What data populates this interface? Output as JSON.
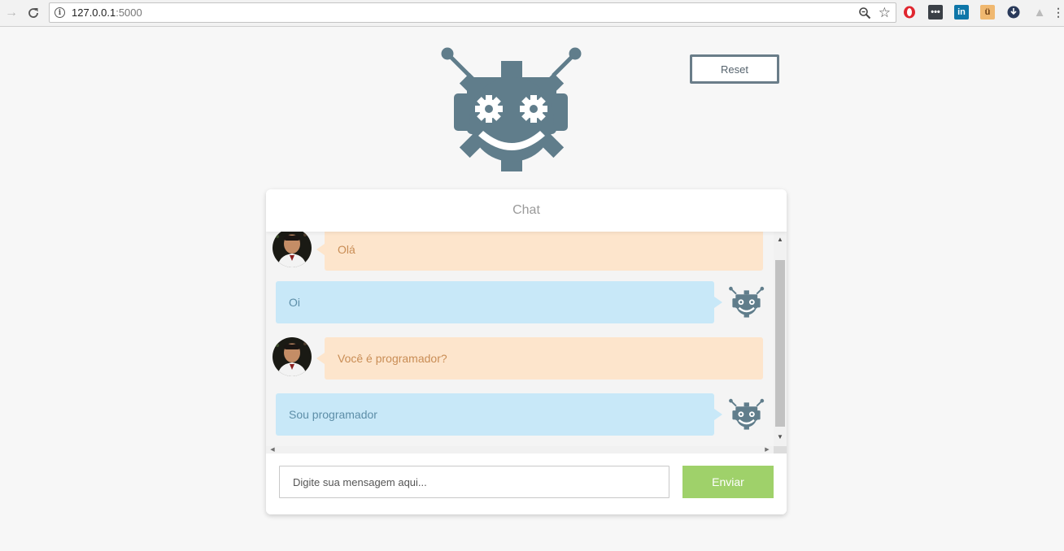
{
  "browser": {
    "url_host": "127.0.0.1",
    "url_port": ":5000",
    "icons": [
      "arrow-forward-icon",
      "reload-icon",
      "site-info-icon",
      "zoom-icon",
      "bookmark-star-icon"
    ],
    "extensions": [
      "opera-icon",
      "ext-dots-icon",
      "linkedin-icon",
      "ext-face-icon",
      "ext-download-icon",
      "ext-tree-icon"
    ]
  },
  "page": {
    "reset_label": "Reset",
    "chat_title": "Chat",
    "input_placeholder": "Digite sua mensagem aqui...",
    "send_label": "Enviar"
  },
  "messages": [
    {
      "sender": "user",
      "text": "Olá"
    },
    {
      "sender": "bot",
      "text": "Oi"
    },
    {
      "sender": "user",
      "text": "Você é programador?"
    },
    {
      "sender": "bot",
      "text": "Sou programador"
    }
  ],
  "colors": {
    "user_bubble": "#fde5cc",
    "bot_bubble": "#c8e8f8",
    "send_button": "#9fd16a",
    "robot": "#607d8b"
  }
}
